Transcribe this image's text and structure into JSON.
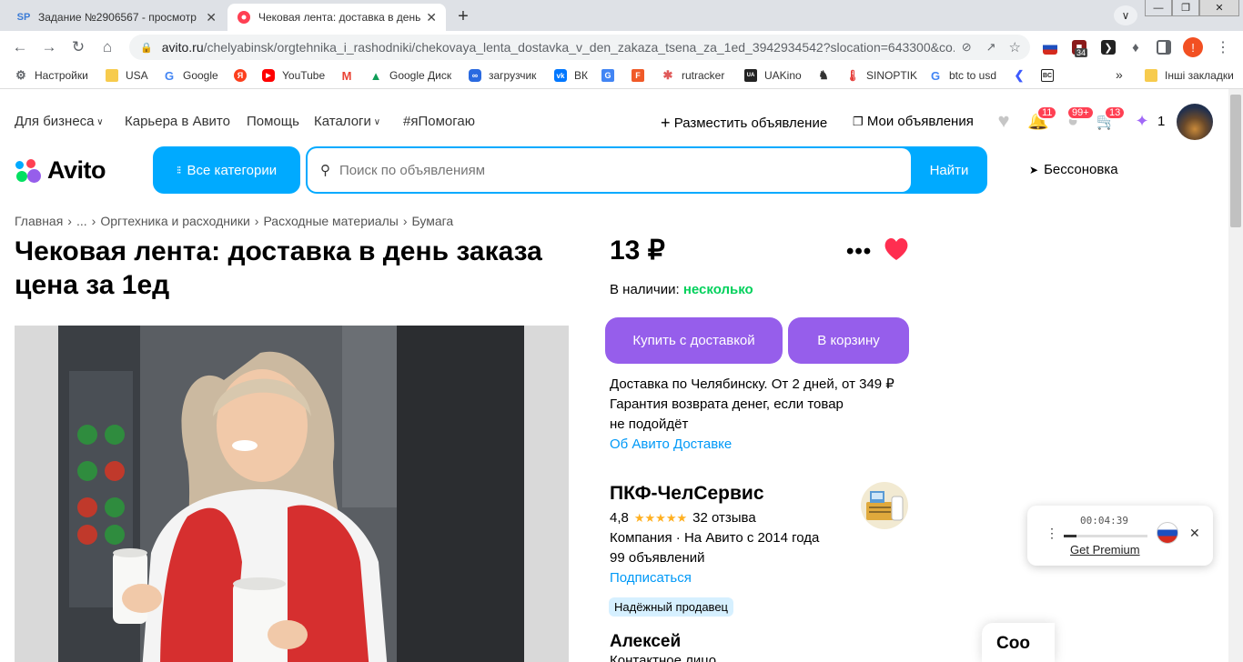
{
  "browser": {
    "tabs": [
      {
        "favicon": "SP",
        "title": "Задание №2906567 - просмотр",
        "close": "✕"
      },
      {
        "favicon": "",
        "title": "Чековая лента: доставка в день",
        "close": "✕"
      }
    ],
    "new_tab": "+",
    "url_host": "avito.ru",
    "url_path": "/chelyabinsk/orgtehnika_i_rashodniki/chekovaya_lenta_dostavka_v_den_zakaza_tsena_za_1ed_3942934542?slocation=643300&co...",
    "extension_badge": "34",
    "profile_initial": "!"
  },
  "bookmarks": [
    {
      "label": "Настройки",
      "icon": "gear-icon",
      "color": "#5f6368"
    },
    {
      "label": "USA",
      "icon": "folder-icon",
      "color": "#f7cb4d"
    },
    {
      "label": "Google",
      "icon": "google-icon",
      "color": "#4285f4"
    },
    {
      "label": "",
      "icon": "yandex-icon",
      "color": "#fc3f1d"
    },
    {
      "label": "YouTube",
      "icon": "youtube-icon",
      "color": "#ff0000"
    },
    {
      "label": "",
      "icon": "gmail-icon",
      "color": "#ea4335"
    },
    {
      "label": "Google Диск",
      "icon": "drive-icon",
      "color": "#0f9d58"
    },
    {
      "label": "загрузчик",
      "icon": "loader-icon",
      "color": "#2a6ae0"
    },
    {
      "label": "ВК",
      "icon": "vk-icon",
      "color": "#0077ff"
    },
    {
      "label": "",
      "icon": "translate-icon",
      "color": "#4285f4"
    },
    {
      "label": "",
      "icon": "f-icon",
      "color": "#f05a28"
    },
    {
      "label": "rutracker",
      "icon": "rutracker-icon",
      "color": "#e05a5a"
    },
    {
      "label": "UAKino",
      "icon": "uakino-icon",
      "color": "#222222"
    },
    {
      "label": "",
      "icon": "chess-icon",
      "color": "#333333"
    },
    {
      "label": "SINOPTIK",
      "icon": "thermometer-icon",
      "color": "#e53935"
    },
    {
      "label": "btc to usd",
      "icon": "google-icon",
      "color": "#4285f4"
    },
    {
      "label": "",
      "icon": "arrow-icon",
      "color": "#3d5afe"
    },
    {
      "label": "",
      "icon": "bc-icon",
      "color": "#222222"
    }
  ],
  "bookmarks_more": "»",
  "bookmarks_other": "Інші закладки",
  "avito": {
    "top_nav": [
      "Для бизнеса",
      "Карьера в Авито",
      "Помощь",
      "Каталоги",
      "#яПомогаю"
    ],
    "post_ad": "Разместить объявление",
    "my_ads": "Мои объявления",
    "badges": {
      "notifications": "11",
      "messages": "99+",
      "cart": "13",
      "promo_count": "1"
    },
    "logo_text": "Avito",
    "all_categories": "Все категории",
    "search_placeholder": "Поиск по объявлениям",
    "search_button": "Найти",
    "city": "Бессоновка",
    "breadcrumbs": [
      "Главная",
      "...",
      "Оргтехника и расходники",
      "Расходные материалы",
      "Бумага"
    ],
    "title": "Чековая лента: доставка в день заказа цена за 1ед",
    "price": "13 ₽",
    "more": "•••",
    "stock_label": "В наличии:",
    "stock_value": "несколько",
    "buy_button": "Купить с доставкой",
    "cart_button": "В корзину",
    "delivery_line1": "Доставка по Челябинску. От 2 дней, от 349 ₽",
    "delivery_line2": "Гарантия возврата денег, если товар",
    "delivery_line3": "не подойдёт",
    "delivery_link": "Об Авито Доставке",
    "seller_name": "ПКФ-ЧелСервис",
    "seller_rating": "4,8",
    "seller_stars": "★★★★★",
    "seller_reviews": "32 отзыва",
    "seller_info": "Компания · На Авито с 2014 года",
    "seller_ads": "99 объявлений",
    "subscribe": "Подписаться",
    "trusted_badge": "Надёжный продавец",
    "contact_name": "Алексей",
    "contact_role": "Контактное лицо",
    "chat_stub": "Соо",
    "brand_blue": "#00aaff",
    "brand_purple": "#965eeb",
    "favorite_red": "#ff2e50"
  },
  "player_widget": {
    "time": "00:04:39",
    "link": "Get Premium",
    "progress_fraction": 0.15,
    "close": "✕",
    "menu": "⋮"
  }
}
